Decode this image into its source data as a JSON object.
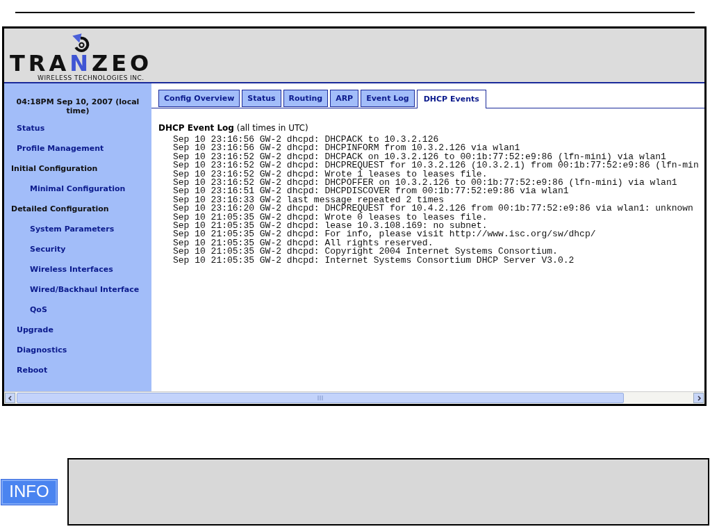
{
  "logo": {
    "wordmark": [
      {
        "text": "TRA",
        "accent": false
      },
      {
        "text": "N",
        "accent": true
      },
      {
        "text": "ZEO",
        "accent": false
      }
    ],
    "tagline": "WIRELESS TECHNOLOGIES INC."
  },
  "sidebar": {
    "clock": "04:18PM Sep 10, 2007 (local time)",
    "items": [
      {
        "kind": "link",
        "label": "Status"
      },
      {
        "kind": "link",
        "label": "Profile Management"
      },
      {
        "kind": "section",
        "label": "Initial Configuration",
        "children": [
          {
            "kind": "link",
            "label": "Minimal Configuration"
          }
        ]
      },
      {
        "kind": "section",
        "label": "Detailed Configuration",
        "children": [
          {
            "kind": "link",
            "label": "System Parameters"
          },
          {
            "kind": "link",
            "label": "Security"
          },
          {
            "kind": "link",
            "label": "Wireless Interfaces"
          },
          {
            "kind": "link",
            "label": "Wired/Backhaul Interface"
          },
          {
            "kind": "link",
            "label": "QoS"
          }
        ]
      },
      {
        "kind": "link",
        "label": "Upgrade"
      },
      {
        "kind": "link",
        "label": "Diagnostics"
      },
      {
        "kind": "link",
        "label": "Reboot"
      }
    ]
  },
  "tabs": [
    {
      "label": "Config Overview",
      "selected": false
    },
    {
      "label": "Status",
      "selected": false
    },
    {
      "label": "Routing",
      "selected": false
    },
    {
      "label": "ARP",
      "selected": false
    },
    {
      "label": "Event Log",
      "selected": false
    },
    {
      "label": "DHCP Events",
      "selected": true
    }
  ],
  "log": {
    "title": "**DHCP Event Log** (all times in UTC)",
    "lines": [
      "Sep 10 23:16:56 GW-2 dhcpd: DHCPACK to 10.3.2.126",
      "Sep 10 23:16:56 GW-2 dhcpd: DHCPINFORM from 10.3.2.126 via wlan1",
      "Sep 10 23:16:52 GW-2 dhcpd: DHCPACK on 10.3.2.126 to 00:1b:77:52:e9:86 (lfn-mini) via wlan1",
      "Sep 10 23:16:52 GW-2 dhcpd: DHCPREQUEST for 10.3.2.126 (10.3.2.1) from 00:1b:77:52:e9:86 (lfn-min",
      "Sep 10 23:16:52 GW-2 dhcpd: Wrote 1 leases to leases file.",
      "Sep 10 23:16:52 GW-2 dhcpd: DHCPOFFER on 10.3.2.126 to 00:1b:77:52:e9:86 (lfn-mini) via wlan1",
      "Sep 10 23:16:51 GW-2 dhcpd: DHCPDISCOVER from 00:1b:77:52:e9:86 via wlan1",
      "Sep 10 23:16:33 GW-2 last message repeated 2 times",
      "Sep 10 23:16:20 GW-2 dhcpd: DHCPREQUEST for 10.4.2.126 from 00:1b:77:52:e9:86 via wlan1: unknown",
      "Sep 10 21:05:35 GW-2 dhcpd: Wrote 0 leases to leases file.",
      "Sep 10 21:05:35 GW-2 dhcpd: lease 10.3.108.169: no subnet.",
      "Sep 10 21:05:35 GW-2 dhcpd: For info, please visit http://www.isc.org/sw/dhcp/",
      "Sep 10 21:05:35 GW-2 dhcpd: All rights reserved.",
      "Sep 10 21:05:35 GW-2 dhcpd: Copyright 2004 Internet Systems Consortium.",
      "Sep 10 21:05:35 GW-2 dhcpd: Internet Systems Consortium DHCP Server V3.0.2"
    ]
  },
  "info": {
    "badge": "INFO"
  }
}
